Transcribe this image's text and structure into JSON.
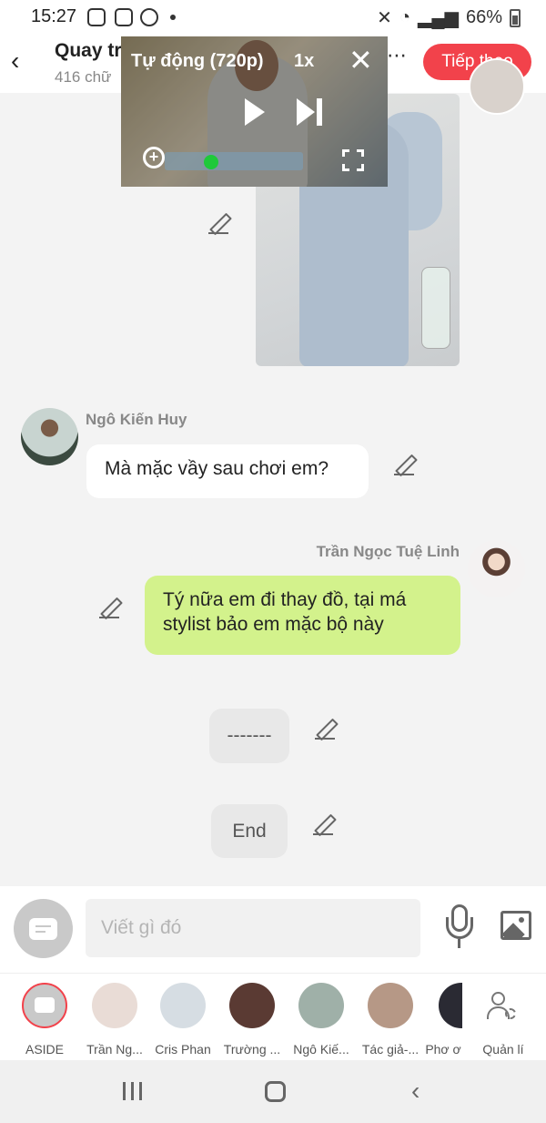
{
  "status_bar": {
    "time": "15:27",
    "battery": "66%"
  },
  "header": {
    "title": "Quay trở lại",
    "subtitle": "416 chữ",
    "more": "⋯",
    "next_button": "Tiếp theo"
  },
  "video_player": {
    "quality": "Tự động (720p)",
    "speed": "1x",
    "progress": 0.22
  },
  "messages": {
    "huy": {
      "sender": "Ngô Kiến Huy",
      "text": "Mà mặc vầy sau chơi em?"
    },
    "linh": {
      "sender": "Trần Ngọc Tuệ Linh",
      "text": "Tý nữa em đi thay đồ, tại má stylist bảo em mặc bộ này"
    },
    "separator": {
      "text": "-------"
    },
    "end": {
      "text": "End"
    }
  },
  "input": {
    "placeholder": "Viết gì đó"
  },
  "characters": [
    {
      "name": "ASIDE"
    },
    {
      "name": "Trần Ng...",
      "color": "#e9dcd6"
    },
    {
      "name": "Cris Phan",
      "color": "#d6dde3"
    },
    {
      "name": "Trường ...",
      "color": "#5a3a33"
    },
    {
      "name": "Ngô Kiế...",
      "color": "#9fb0a8"
    },
    {
      "name": "Tác giả-...",
      "color": "#b69886"
    },
    {
      "name": "Phơ ơ",
      "color": "#2a2a33"
    },
    {
      "name": "Quản lí"
    }
  ],
  "colors": {
    "accent": "#f2424b",
    "bubble_green": "#d3f28c"
  }
}
